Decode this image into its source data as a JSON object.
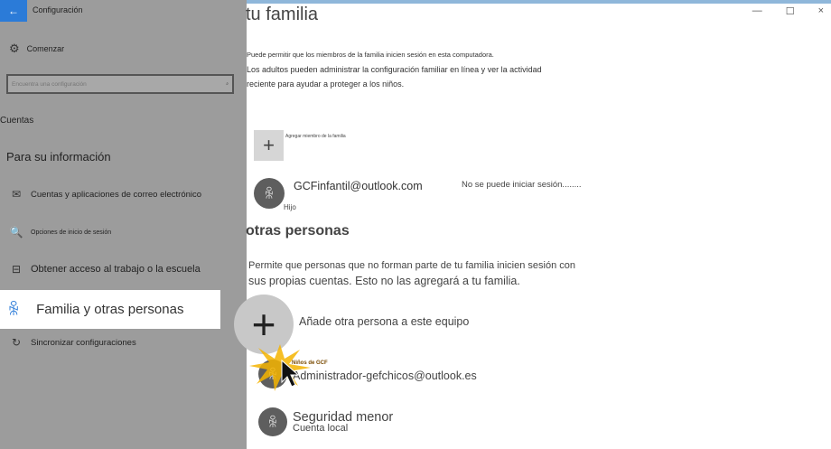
{
  "window": {
    "app_title": "Configuración",
    "controls": {
      "minimize": "—",
      "maximize": "☐",
      "close": "×"
    }
  },
  "sidebar": {
    "home_label": "Comenzar",
    "search_placeholder": "Encuentra una configuración",
    "section_accounts": "Cuentas",
    "section_info": "Para su información",
    "items": [
      {
        "label": "Cuentas y aplicaciones de correo electrónico",
        "icon": "mail-icon"
      },
      {
        "label": "Opciones de inicio de sesión",
        "icon": "key-icon"
      },
      {
        "label": "Obtener acceso al trabajo o la escuela",
        "icon": "briefcase-icon"
      },
      {
        "label": "Familia y otras personas",
        "icon": "person-icon",
        "selected": true
      },
      {
        "label": "Sincronizar configuraciones",
        "icon": "sync-icon"
      }
    ]
  },
  "main": {
    "family_title": "tu familia",
    "family_desc_line1": "Puede permitir que los miembros de la familia inicien sesión en esta computadora.",
    "family_desc_line2": "Los adultos pueden administrar la configuración familiar en línea y ver la actividad",
    "family_desc_line3": "reciente para ayudar a proteger a los niños.",
    "add_family_label": "Agregar miembro de la familia",
    "member": {
      "email": "GCFinfantil@outlook.com",
      "role": "Hijo",
      "status": "No se puede iniciar sesión........"
    },
    "others_title": "otras personas",
    "others_desc_line1": "Permite que personas que no forman parte de tu familia inicien sesión con",
    "others_desc_line2": "sus propias cuentas. Esto no las agregará a tu familia.",
    "add_other_label": "Añade otra persona a este equipo",
    "tooltip": "Niños de GCF",
    "accounts": [
      {
        "name": "Administrador-gefchicos@outlook.es"
      },
      {
        "name": "Seguridad menor",
        "sub": "Cuenta local"
      }
    ]
  },
  "colors": {
    "accent": "#2b7bd8",
    "sidebar_bg": "#9c9c9c",
    "burst": "#f5b400"
  }
}
